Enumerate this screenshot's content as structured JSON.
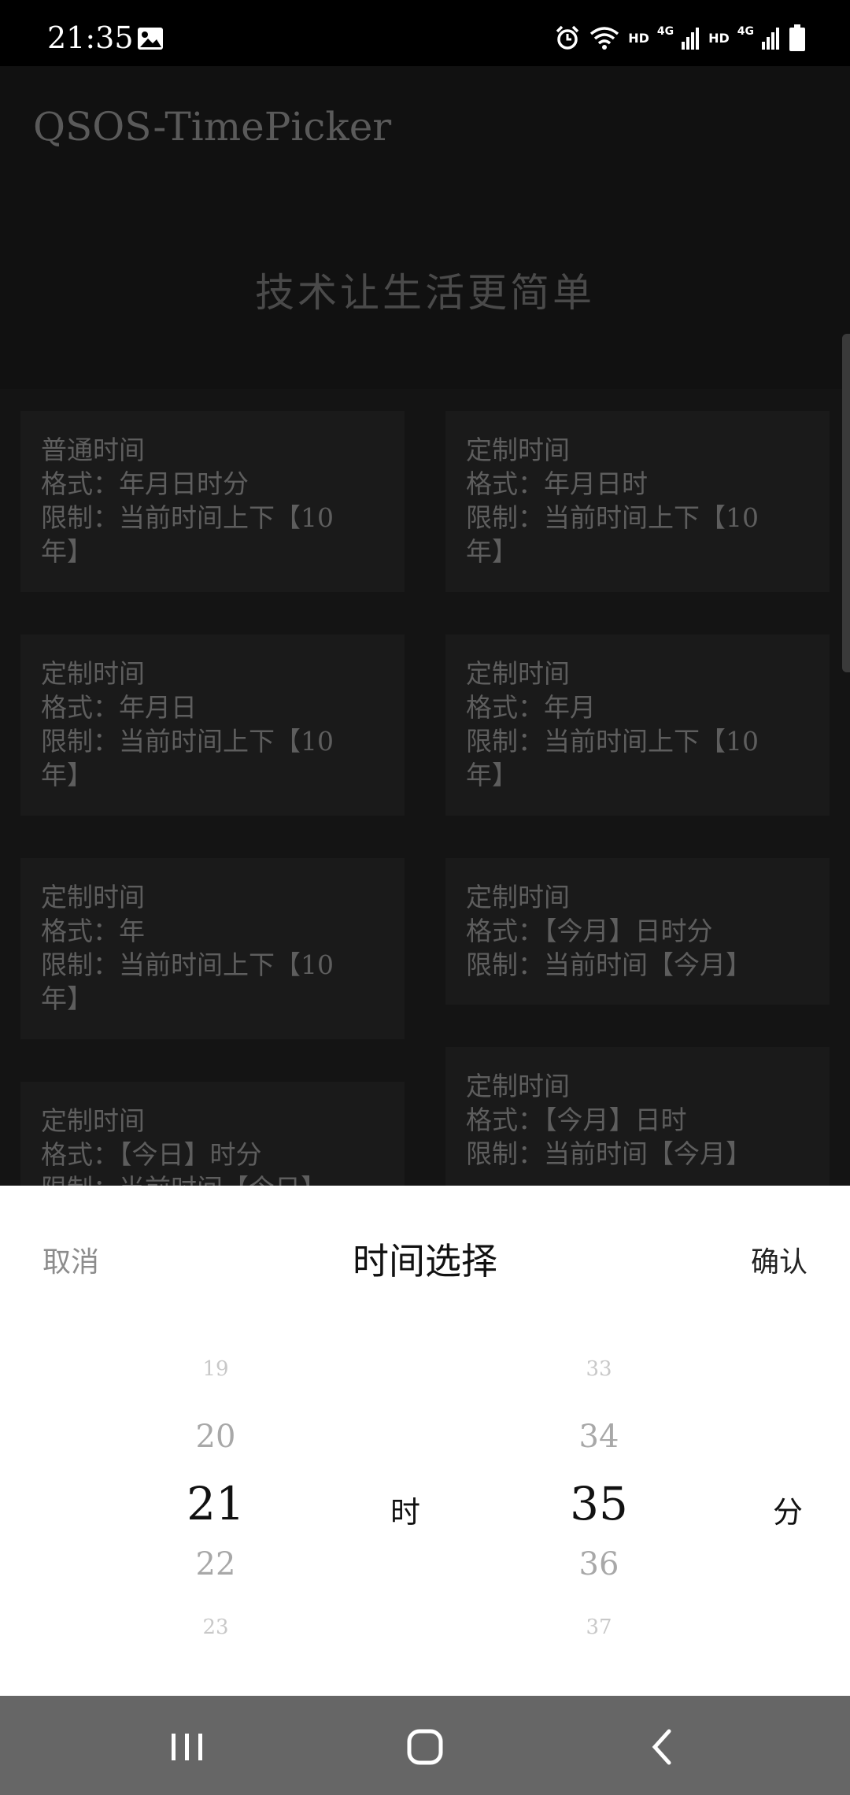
{
  "status_bar": {
    "time": "21:35",
    "icons": [
      "gallery-icon",
      "alarm-icon",
      "wifi-icon",
      "signal-icon",
      "signal-icon",
      "battery-icon"
    ],
    "hd1": "HD",
    "hd2": "HD",
    "net1": "4G",
    "net2": "4G"
  },
  "app": {
    "title": "QSOS-TimePicker",
    "slogan": "技术让生活更简单"
  },
  "cards": [
    {
      "lines": [
        "普通时间",
        "格式：年月日时分",
        "限制：当前时间上下【10",
        "年】"
      ]
    },
    {
      "lines": [
        "定制时间",
        "格式：年月日时",
        "限制：当前时间上下【10",
        "年】"
      ]
    },
    {
      "lines": [
        "定制时间",
        "格式：年月日",
        "限制：当前时间上下【10",
        "年】"
      ]
    },
    {
      "lines": [
        "定制时间",
        "格式：年月",
        "限制：当前时间上下【10",
        "年】"
      ]
    },
    {
      "lines": [
        "定制时间",
        "格式：年",
        "限制：当前时间上下【10",
        "年】"
      ]
    },
    {
      "lines": [
        "定制时间",
        "格式：【今月】日时分",
        "限制：当前时间【今月】"
      ]
    },
    {
      "lines": [
        "定制时间",
        "格式：【今日】时分",
        "限制：当前时间【今日】"
      ]
    },
    {
      "lines": [
        "定制时间",
        "格式：【今月】日时",
        "限制：当前时间【今月】"
      ]
    }
  ],
  "picker": {
    "cancel": "取消",
    "title": "时间选择",
    "confirm": "确认",
    "hour": {
      "values": [
        "19",
        "20",
        "21",
        "22",
        "23"
      ],
      "unit": "时"
    },
    "minute": {
      "values": [
        "33",
        "34",
        "35",
        "36",
        "37"
      ],
      "unit": "分"
    }
  },
  "nav": {
    "icons": [
      "recent-apps-icon",
      "home-icon",
      "back-icon"
    ]
  },
  "colors": {
    "status_bar": "#000000",
    "overlay_bg": "#141414",
    "sheet_bg": "#ffffff",
    "nav_bar": "#666666"
  }
}
